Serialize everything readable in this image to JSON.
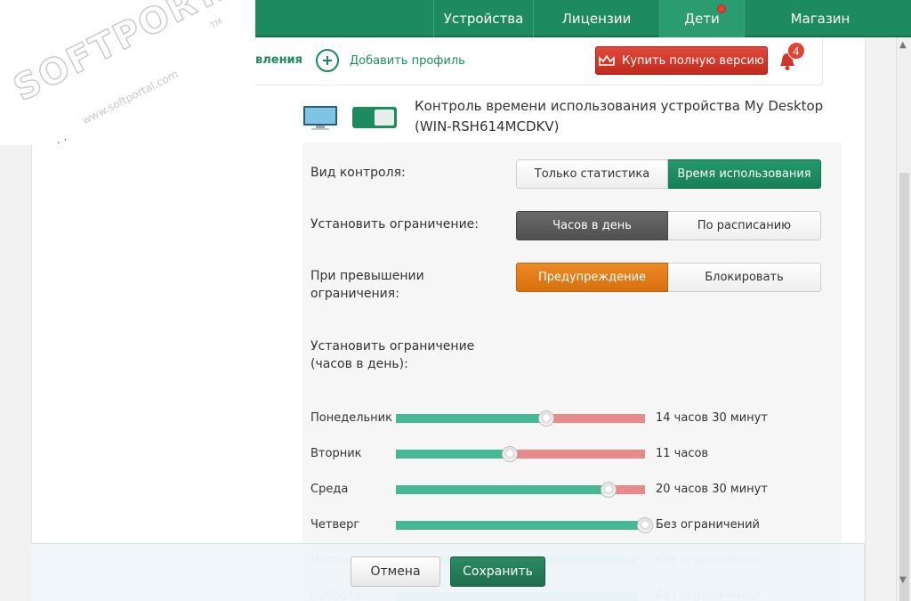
{
  "nav": {
    "items": [
      {
        "label": "Устройства"
      },
      {
        "label": "Лицензии"
      },
      {
        "label": "Дети"
      },
      {
        "label": "Магазин"
      }
    ]
  },
  "subheader": {
    "left_fragment": "вления",
    "add_profile_label": "Добавить профиль",
    "buy_label": "Купить полную версию",
    "notification_count": "4"
  },
  "watermark": {
    "title": "SOFTPORTAL",
    "subtitle": "www.softportal.com",
    "tm": "TM"
  },
  "side_fragment": ". ·",
  "device": {
    "title": "Контроль времени использования устройства My Desktop (WIN-RSH614MCDKV)",
    "toggle_on": true
  },
  "settings": {
    "control_type": {
      "label": "Вид контроля:",
      "options": [
        "Только статистика",
        "Время использования"
      ],
      "selected": "Время использования"
    },
    "limit_type": {
      "label": "Установить ограничение:",
      "options": [
        "Часов в день",
        "По расписанию"
      ],
      "selected": "Часов в день"
    },
    "on_exceed": {
      "label": "При превышении ограничения:",
      "options": [
        "Предупреждение",
        "Блокировать"
      ],
      "selected": "Предупреждение"
    },
    "hours_label": "Установить ограничение (часов в день):",
    "days": [
      {
        "name": "Понедельник",
        "value": "14 часов 30 минут",
        "hours": 14.5
      },
      {
        "name": "Вторник",
        "value": "11 часов",
        "hours": 11
      },
      {
        "name": "Среда",
        "value": "20 часов 30 минут",
        "hours": 20.5
      },
      {
        "name": "Четверг",
        "value": "Без ограничений",
        "hours": 24
      },
      {
        "name": "Пятница",
        "value": "Без ограничений",
        "hours": 24
      },
      {
        "name": "Суббота",
        "value": "Без ограничений",
        "hours": 24
      }
    ]
  },
  "footer": {
    "cancel_label": "Отмена",
    "save_label": "Сохранить"
  },
  "colors": {
    "brand_green": "#1d8a5f",
    "slider_allowed": "#46b896",
    "slider_blocked": "#e88a8a",
    "warning_orange": "#e37f1b",
    "buy_red": "#d2352a"
  }
}
